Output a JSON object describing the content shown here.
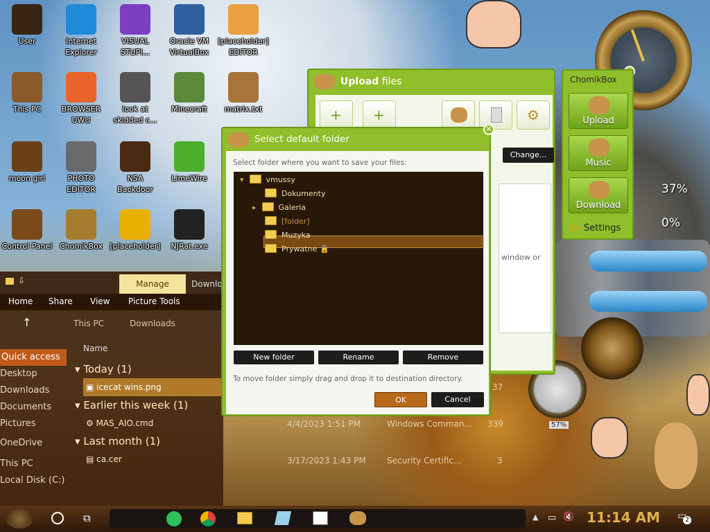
{
  "desktop": {
    "icons": [
      {
        "label": "User",
        "icon": "user-folder-icon",
        "color": "#3a2412"
      },
      {
        "label": "Internet Explorer",
        "icon": "edge-icon",
        "color": "#1f8ad8"
      },
      {
        "label": "VISUAL STUPI...",
        "icon": "visual-studio-icon",
        "color": "#7b3fbf"
      },
      {
        "label": "Oracle VM VirtualBox",
        "icon": "virtualbox-icon",
        "color": "#2f5f9e"
      },
      {
        "label": "[placeholder] EDITOR",
        "icon": "hxd-editor-icon",
        "color": "#e8a040"
      },
      {
        "label": "This PC",
        "icon": "this-pc-icon",
        "color": "#8a5a2a"
      },
      {
        "label": "BROWSER UWU",
        "icon": "firefox-icon",
        "color": "#e9642a"
      },
      {
        "label": "look at skidded c...",
        "icon": "shortcut-icon",
        "color": "#555"
      },
      {
        "label": "Minecraft",
        "icon": "minecraft-icon",
        "color": "#5b8a3a"
      },
      {
        "label": "matrix.txt",
        "icon": "text-file-icon",
        "color": "#a8743a"
      },
      {
        "label": "moon girl",
        "icon": "image-folder-icon",
        "color": "#6a4018"
      },
      {
        "label": "PHOTO EDITOR",
        "icon": "gimp-icon",
        "color": "#6a6a6a"
      },
      {
        "label": "NSA Backdoor",
        "icon": "book-icon",
        "color": "#4a2a10"
      },
      {
        "label": "LimeWire",
        "icon": "limewire-icon",
        "color": "#4cae2a"
      },
      {
        "label": "Control Panel",
        "icon": "control-panel-icon",
        "color": "#7a4a1a"
      },
      {
        "label": "ChomikBox",
        "icon": "chomikbox-icon",
        "color": "#a67c2e"
      },
      {
        "label": "[placeholder]",
        "icon": "de-app-icon",
        "color": "#e8b000"
      },
      {
        "label": "NJRat.exe",
        "icon": "skull-icon",
        "color": "#222"
      }
    ]
  },
  "explorer": {
    "ribbon_manage": "Manage",
    "ribbon_other": "Downlo",
    "menu": [
      "Home",
      "Share",
      "View",
      "Picture Tools"
    ],
    "address": [
      "This PC",
      "Downloads"
    ],
    "column_name": "Name",
    "sidebar": [
      "Quick access",
      "Desktop",
      "Downloads",
      "Documents",
      "Pictures",
      "OneDrive",
      "This PC",
      "Local Disk (C:)"
    ],
    "groups": [
      {
        "label": "Today (1)",
        "files": [
          {
            "name": "icecat wins.png",
            "date": "",
            "type": "",
            "size": "37"
          }
        ]
      },
      {
        "label": "Earlier this week (1)",
        "files": [
          {
            "name": "MAS_AIO.cmd",
            "date": "4/4/2023 1:51 PM",
            "type": "Windows Comman...",
            "size": "339"
          }
        ]
      },
      {
        "label": "Last month (1)",
        "files": [
          {
            "name": "ca.cer",
            "date": "3/17/2023 1:43 PM",
            "type": "Security Certific...",
            "size": "3"
          }
        ]
      }
    ]
  },
  "upload": {
    "title_bold": "Upload",
    "title_rest": "files",
    "change_label": "Change...",
    "side_text": "window or"
  },
  "dialog": {
    "title": "Select default folder",
    "hint": "Select folder where you want to save your files:",
    "tree": [
      {
        "name": "vmussy",
        "level": 0,
        "expanded": true
      },
      {
        "name": "Dokumenty",
        "level": 1
      },
      {
        "name": "Galeria",
        "level": 1,
        "expandable": true
      },
      {
        "name": "[folder]",
        "level": 1,
        "selected": true
      },
      {
        "name": "Muzyka",
        "level": 1
      },
      {
        "name": "Prywatne",
        "level": 1,
        "locked": true
      }
    ],
    "new_folder": "New folder",
    "rename": "Rename",
    "remove": "Remove",
    "drag_hint": "To move folder simply drag and drop it to destination directory.",
    "ok": "OK",
    "cancel": "Cancel"
  },
  "chomikbox": {
    "title": "ChomikBox",
    "buttons": [
      "Upload",
      "Music",
      "Download"
    ],
    "settings": "Settings",
    "gauge_1": "37%",
    "gauge_2": "0%",
    "dial": "57%"
  },
  "taskbar": {
    "time": "11:14 AM",
    "notifications": "2"
  },
  "colors": {
    "chomik_green": "#8fbf2a",
    "dialog_tree_bg": "#281808",
    "button_dark": "#1e1d1b",
    "ok_orange": "#b86a1a"
  }
}
